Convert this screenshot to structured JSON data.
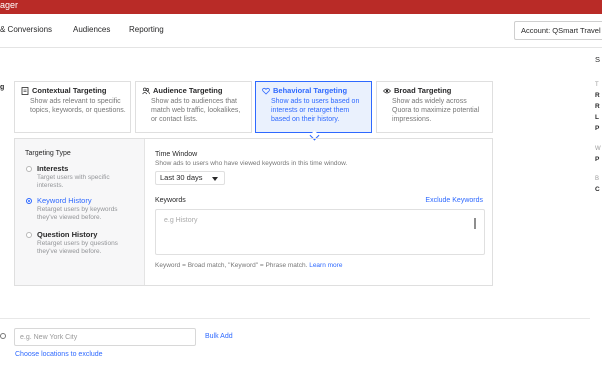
{
  "app": {
    "title_fragment": "ager"
  },
  "nav": {
    "items": [
      "& Conversions",
      "Audiences",
      "Reporting"
    ],
    "account": "Account: QSmart Travel"
  },
  "left_edge": {
    "cut_label": "g",
    "location_icon": "info-icon"
  },
  "cards": [
    {
      "icon": "document-icon",
      "title": "Contextual Targeting",
      "desc": "Show ads relevant to specific topics, keywords, or questions."
    },
    {
      "icon": "people-icon",
      "title": "Audience Targeting",
      "desc": "Show ads to audiences that match web traffic, lookalikes, or contact lists."
    },
    {
      "icon": "heart-icon",
      "title": "Behavioral Targeting",
      "desc": "Show ads to users based on interests or retarget them based on their history."
    },
    {
      "icon": "eye-icon",
      "title": "Broad Targeting",
      "desc": "Show ads widely across Quora to maximize potential impressions."
    }
  ],
  "targeting_type": {
    "title": "Targeting Type",
    "options": [
      {
        "label": "Interests",
        "desc": "Target users with specific interests."
      },
      {
        "label": "Keyword History",
        "desc": "Retarget users by keywords they've viewed before."
      },
      {
        "label": "Question History",
        "desc": "Retarget users by questions they've viewed before."
      }
    ],
    "selected_index": 1
  },
  "time_window": {
    "title": "Time Window",
    "desc": "Show ads to users who have viewed keywords in this time window.",
    "selected": "Last 30 days"
  },
  "keywords": {
    "title": "Keywords",
    "exclude_label": "Exclude Keywords",
    "placeholder": "e.g History",
    "help": "Keyword = Broad match, \"Keyword\" = Phrase match.",
    "learn_more": "Learn more"
  },
  "locations": {
    "placeholder": "e.g. New York City",
    "bulk_add": "Bulk Add",
    "exclude_link": "Choose locations to exclude"
  },
  "side": {
    "header": "S",
    "group1_label": "T",
    "group1_items": [
      "R",
      "R",
      "L",
      "P"
    ],
    "group2_label": "W",
    "group2_item": "P",
    "group3_label": "B",
    "group3_item": "C"
  },
  "colors": {
    "brand_red": "#b92b27",
    "link_blue": "#2e69ff"
  }
}
